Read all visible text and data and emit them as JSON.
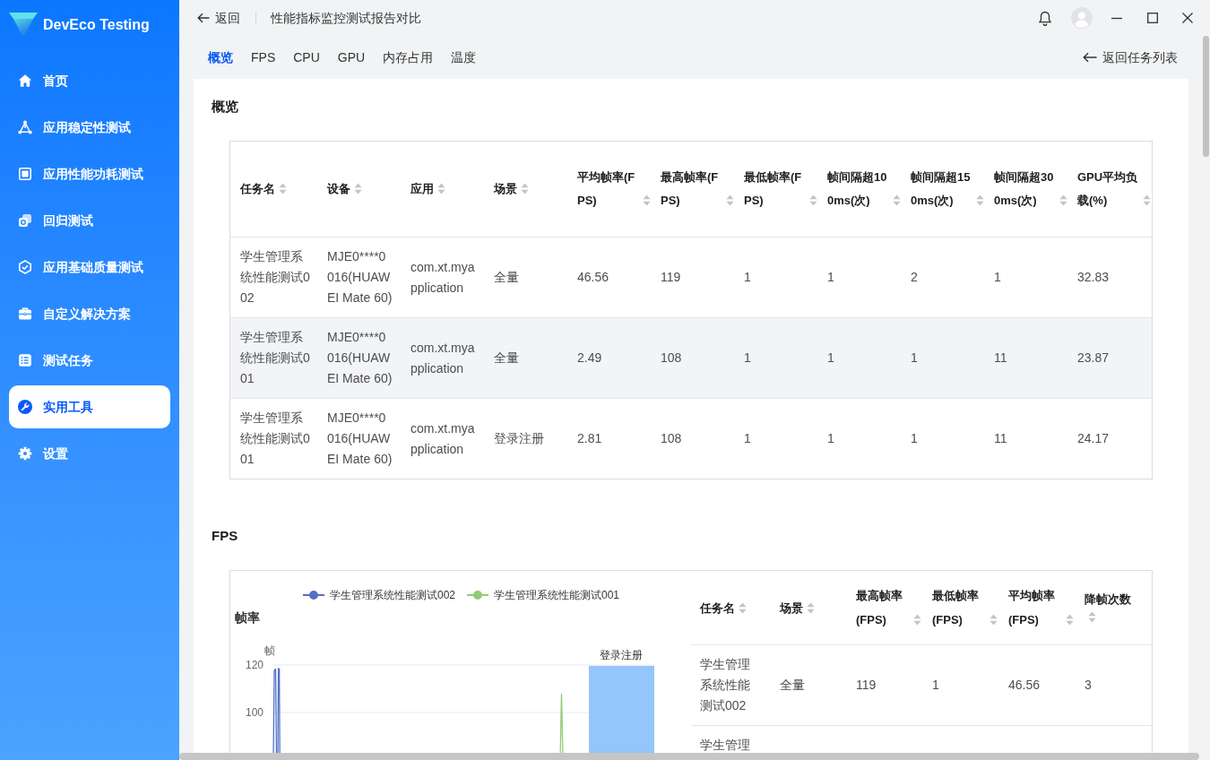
{
  "app": {
    "name": "DevEco Testing"
  },
  "sidebar": {
    "items": [
      {
        "label": "首页",
        "selected": false
      },
      {
        "label": "应用稳定性测试",
        "selected": false
      },
      {
        "label": "应用性能功耗测试",
        "selected": false
      },
      {
        "label": "回归测试",
        "selected": false
      },
      {
        "label": "应用基础质量测试",
        "selected": false
      },
      {
        "label": "自定义解决方案",
        "selected": false
      },
      {
        "label": "测试任务",
        "selected": false
      },
      {
        "label": "实用工具",
        "selected": true
      },
      {
        "label": "设置",
        "selected": false
      }
    ]
  },
  "header": {
    "back": "返回",
    "title": "性能指标监控测试报告对比"
  },
  "tabs": [
    {
      "label": "概览",
      "selected": true
    },
    {
      "label": "FPS",
      "selected": false
    },
    {
      "label": "CPU",
      "selected": false
    },
    {
      "label": "GPU",
      "selected": false
    },
    {
      "label": "内存占用",
      "selected": false
    },
    {
      "label": "温度",
      "selected": false
    }
  ],
  "back_to_list": "返回任务列表",
  "overview": {
    "title": "概览",
    "table": {
      "columns": [
        "任务名",
        "设备",
        "应用",
        "场景",
        "平均帧率(FPS)",
        "最高帧率(FPS)",
        "最低帧率(FPS)",
        "帧间隔超100ms(次)",
        "帧间隔超150ms(次)",
        "帧间隔超300ms(次)",
        "GPU平均负载(%)"
      ],
      "rows": [
        {
          "highlighted": false,
          "cells": [
            "学生管理系统性能测试002",
            "MJE0****0016(HUAWEI Mate 60)",
            "com.xt.myapplication",
            "全量",
            "46.56",
            "119",
            "1",
            "1",
            "2",
            "1",
            "32.83"
          ]
        },
        {
          "highlighted": true,
          "cells": [
            "学生管理系统性能测试001",
            "MJE0****0016(HUAWEI Mate 60)",
            "com.xt.myapplication",
            "全量",
            "2.49",
            "108",
            "1",
            "1",
            "1",
            "11",
            "23.87"
          ]
        },
        {
          "highlighted": false,
          "cells": [
            "学生管理系统性能测试001",
            "MJE0****0016(HUAWEI Mate 60)",
            "com.xt.myapplication",
            "登录注册",
            "2.81",
            "108",
            "1",
            "1",
            "1",
            "11",
            "24.17"
          ]
        }
      ]
    }
  },
  "fps": {
    "title": "FPS",
    "chart": {
      "title": "帧率",
      "legend": [
        {
          "label": "学生管理系统性能测试002",
          "color": "#5470c6"
        },
        {
          "label": "学生管理系统性能测试001",
          "color": "#91cc75"
        }
      ],
      "y_axis_name": "帧",
      "y_ticks": [
        "120",
        "100"
      ],
      "scene_label": "登录注册"
    },
    "table": {
      "columns": [
        "任务名",
        "场景",
        "最高帧率(FPS)",
        "最低帧率(FPS)",
        "平均帧率(FPS)",
        "降帧次数"
      ],
      "rows": [
        {
          "cells": [
            "学生管理系统性能测试002",
            "全量",
            "119",
            "1",
            "46.56",
            "3"
          ]
        },
        {
          "cells": [
            "学生管理"
          ]
        }
      ]
    }
  }
}
